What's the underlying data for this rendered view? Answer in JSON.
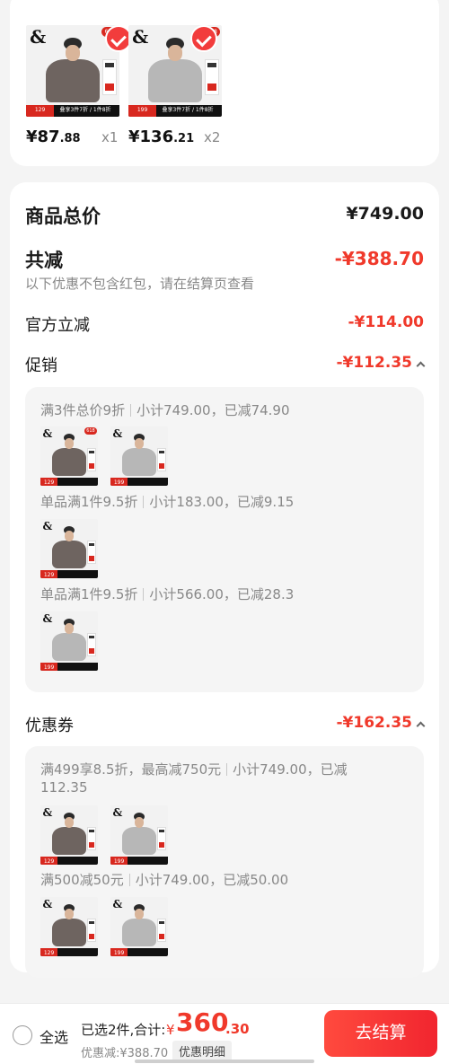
{
  "products": [
    {
      "price_int": "¥87",
      "price_dec": ".88",
      "qty": "x1",
      "tag_price": "129",
      "shirt_color": "#6e6460",
      "badge": "618"
    },
    {
      "price_int": "¥136",
      "price_dec": ".21",
      "qty": "x2",
      "tag_price": "199",
      "shirt_color": "#b7b7b7",
      "badge": "618"
    }
  ],
  "thumb": {
    "logo": "&",
    "slogan": "叠享3件7折 / 1件8折"
  },
  "summary": {
    "total_label": "商品总价",
    "total_value": "¥749.00",
    "reduce_label": "共减",
    "reduce_value": "-¥388.70",
    "reduce_note": "以下优惠不包含红包，请在结算页查看",
    "official_label": "官方立减",
    "official_value": "-¥114.00",
    "promo_label": "促销",
    "promo_value": "-¥112.35",
    "coupon_label": "优惠券",
    "coupon_value": "-¥162.35"
  },
  "promo_groups": [
    {
      "rule": "满3件总价9折",
      "detail": "小计749.00，已减74.90"
    },
    {
      "rule": "单品满1件9.5折",
      "detail": "小计183.00，已减9.15"
    },
    {
      "rule": "单品满1件9.5折",
      "detail": "小计566.00，已减28.3"
    }
  ],
  "coupon_groups": [
    {
      "rule": "满499享8.5折，最高减750元",
      "detail_line1": "小计749.00，已减",
      "detail_line2": "112.35"
    },
    {
      "rule": "满500减50元",
      "detail": "小计749.00，已减50.00"
    }
  ],
  "bottom": {
    "select_all": "全选",
    "selected_summary": "已选2件,合计:",
    "currency": "¥",
    "total_int": "360",
    "total_dec": ".30",
    "discount": "优惠减:¥388.70",
    "detail_button": "优惠明细",
    "checkout": "去结算"
  },
  "colors": {
    "accent": "#f0392b",
    "button": "#f1252f"
  }
}
